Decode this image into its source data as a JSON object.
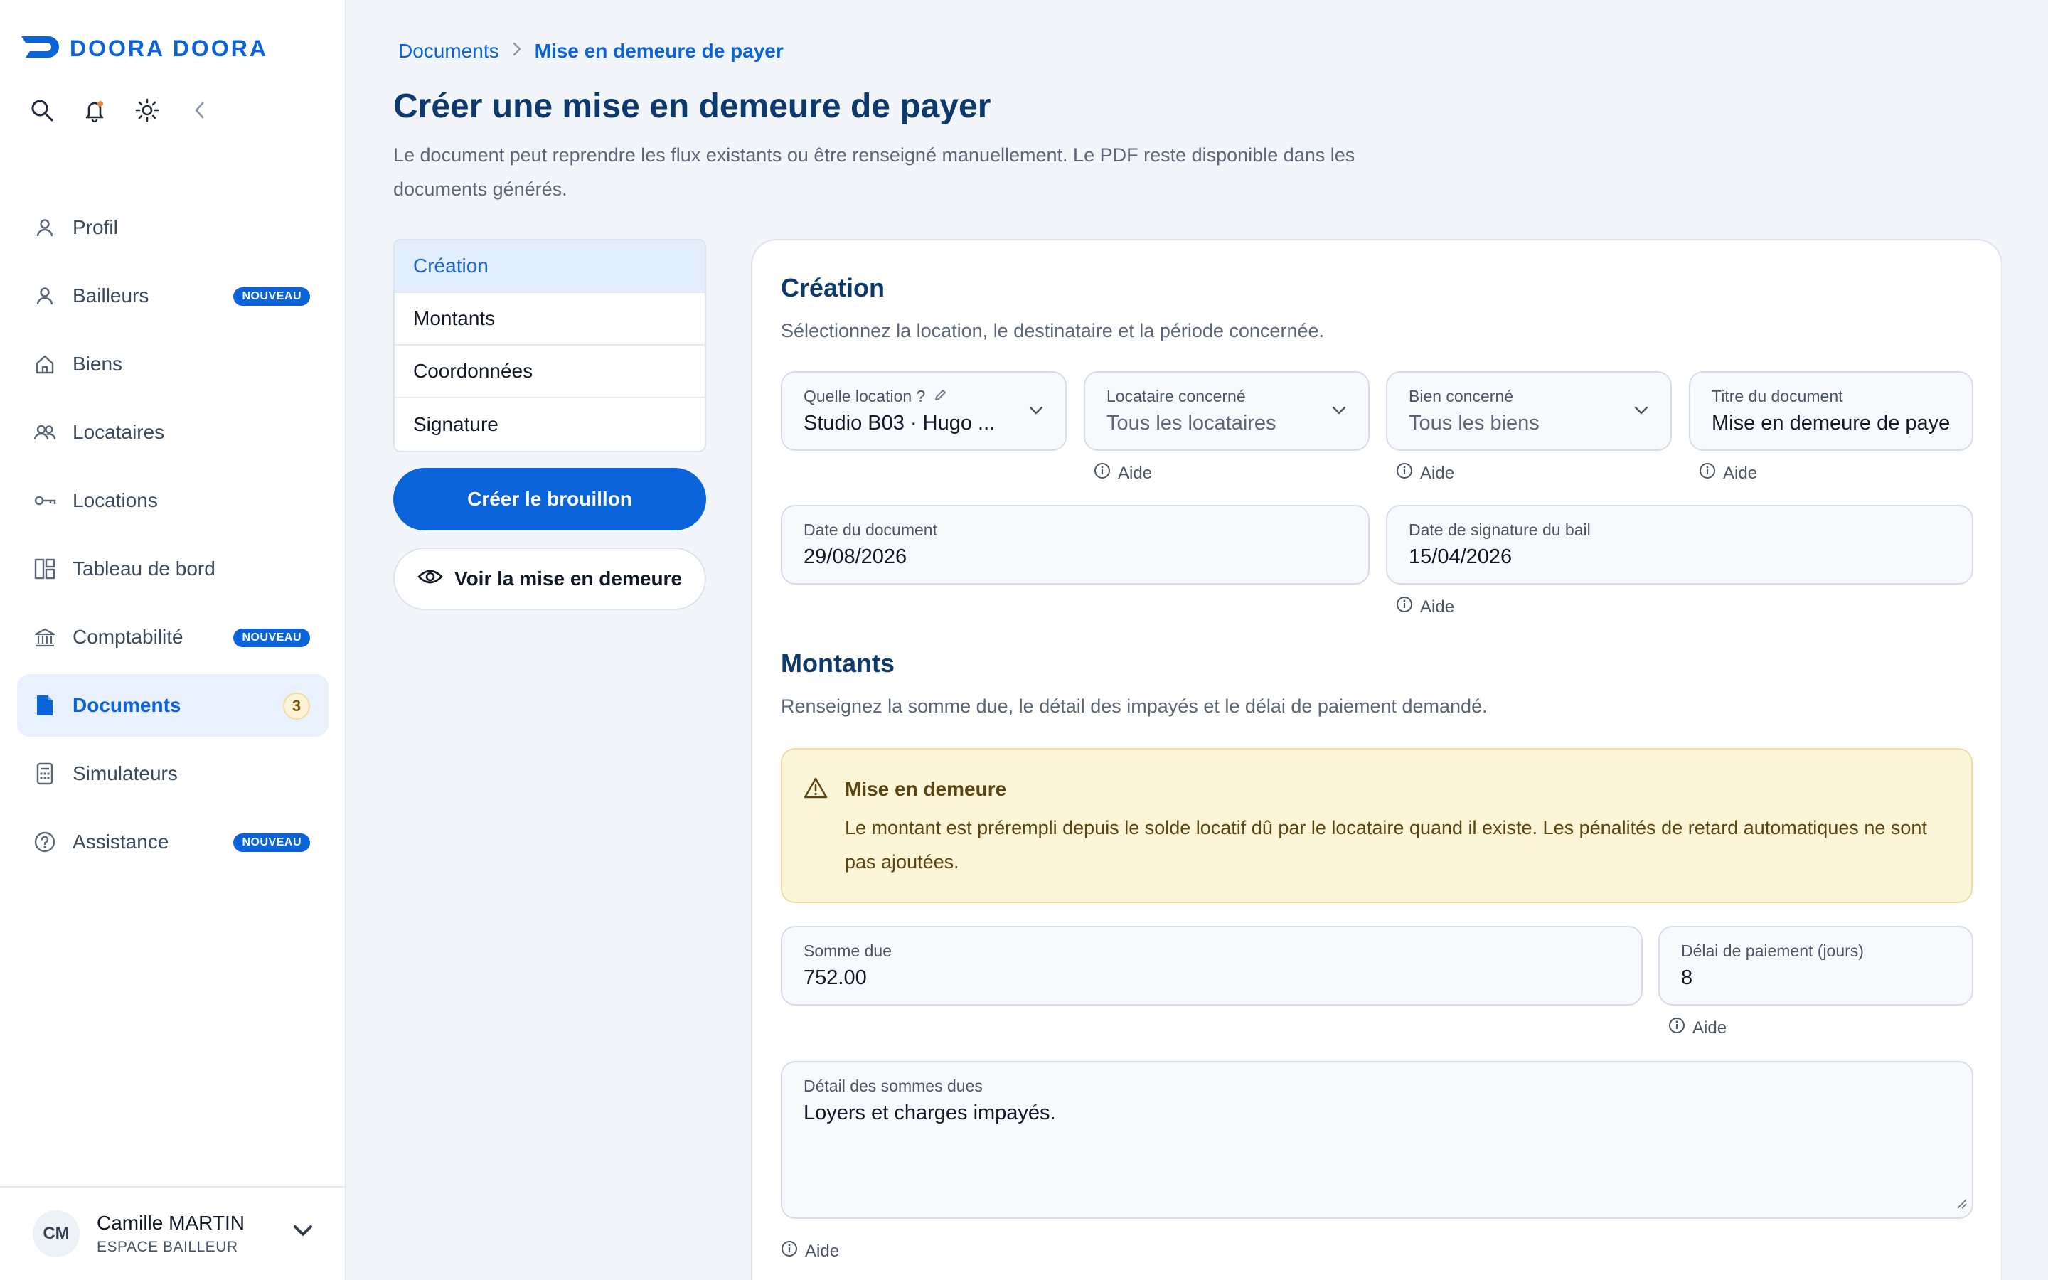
{
  "brand": {
    "name": "DOORA DOORA",
    "color": "#0a63d8"
  },
  "sidebar": {
    "top_icons": [
      "search-icon",
      "bell-icon",
      "sun-icon",
      "collapse-icon"
    ],
    "items": [
      {
        "label": "Profil",
        "icon": "user-icon"
      },
      {
        "label": "Bailleurs",
        "icon": "user-icon",
        "badge": "NOUVEAU"
      },
      {
        "label": "Biens",
        "icon": "home-icon"
      },
      {
        "label": "Locataires",
        "icon": "users-icon"
      },
      {
        "label": "Locations",
        "icon": "key-icon"
      },
      {
        "label": "Tableau de bord",
        "icon": "dashboard-icon"
      },
      {
        "label": "Comptabilité",
        "icon": "bank-icon",
        "badge": "NOUVEAU"
      },
      {
        "label": "Documents",
        "icon": "document-icon",
        "count": "3",
        "active": true
      },
      {
        "label": "Simulateurs",
        "icon": "calculator-icon"
      },
      {
        "label": "Assistance",
        "icon": "help-icon",
        "badge": "NOUVEAU"
      }
    ],
    "user": {
      "initials": "CM",
      "name": "Camille MARTIN",
      "role": "ESPACE BAILLEUR"
    }
  },
  "breadcrumb": {
    "parent": "Documents",
    "current": "Mise en demeure de payer"
  },
  "page": {
    "title": "Créer une mise en demeure de payer",
    "description": "Le document peut reprendre les flux existants ou être renseigné manuellement. Le PDF reste disponible dans les documents générés."
  },
  "steps": [
    "Création",
    "Montants",
    "Coordonnées",
    "Signature"
  ],
  "actions": {
    "create_draft": "Créer le brouillon",
    "preview": "Voir la mise en demeure"
  },
  "creation": {
    "title": "Création",
    "description": "Sélectionnez la location, le destinataire et la période concernée.",
    "location": {
      "label": "Quelle location ?",
      "value": "Studio B03 · Hugo ..."
    },
    "tenant": {
      "label": "Locataire concerné",
      "value": "Tous les locataires"
    },
    "property": {
      "label": "Bien concerné",
      "value": "Tous les biens"
    },
    "doc_title": {
      "label": "Titre du document",
      "value": "Mise en demeure de payer"
    },
    "doc_date": {
      "label": "Date du document",
      "value": "29/08/2026"
    },
    "lease_date": {
      "label": "Date de signature du bail",
      "value": "15/04/2026"
    }
  },
  "help_label": "Aide",
  "montants": {
    "title": "Montants",
    "description": "Renseignez la somme due, le détail des impayés et le délai de paiement demandé.",
    "alert_title": "Mise en demeure",
    "alert_text": "Le montant est prérempli depuis le solde locatif dû par le locataire quand il existe. Les pénalités de retard automatiques ne sont pas ajoutées.",
    "amount": {
      "label": "Somme due",
      "value": "752.00"
    },
    "delay": {
      "label": "Délai de paiement (jours)",
      "value": "8"
    },
    "detail": {
      "label": "Détail des sommes dues",
      "value": "Loyers et charges impayés."
    }
  }
}
